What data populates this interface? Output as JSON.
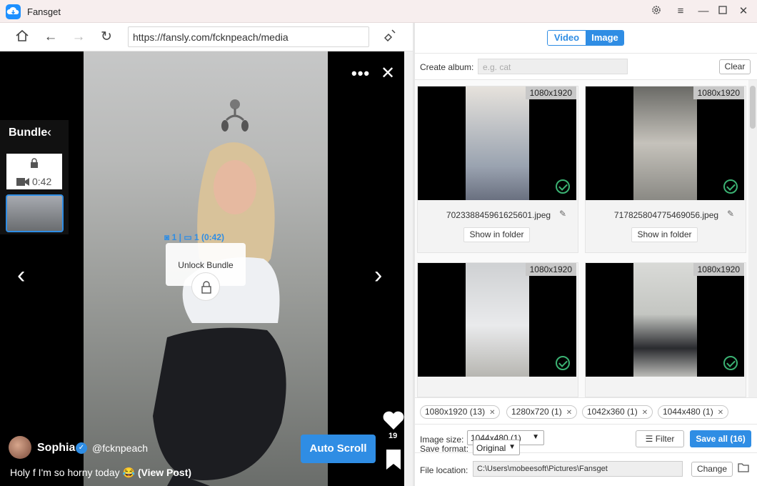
{
  "app": {
    "name": "Fansget"
  },
  "browser": {
    "url": "https://fansly.com/fcknpeach/media"
  },
  "bundle": {
    "title": "Bundle",
    "thumb_duration": "0:42"
  },
  "unlock": {
    "photos": "1",
    "videos": "1 (0:42)",
    "label": "Unlock Bundle"
  },
  "post": {
    "creator_name": "Sophia",
    "creator_handle": "@fcknpeach",
    "caption": "Holy f I'm so horny today 😂",
    "caption_link": "(View Post)",
    "likes": "19",
    "auto_scroll_label": "Auto Scroll"
  },
  "tabs": {
    "video": "Video",
    "image": "Image",
    "active": "Image"
  },
  "album": {
    "label": "Create album:",
    "placeholder": "e.g. cat",
    "clear_label": "Clear"
  },
  "cards": [
    {
      "resolution": "1080x1920",
      "filename": "702338845961625601.jpeg",
      "button": "Show in folder"
    },
    {
      "resolution": "1080x1920",
      "filename": "717825804775469056.jpeg",
      "button": "Show in folder"
    },
    {
      "resolution": "1080x1920",
      "filename": "",
      "button": ""
    },
    {
      "resolution": "1080x1920",
      "filename": "",
      "button": ""
    }
  ],
  "size_tags": [
    "1080x1920 (13)",
    "1280x720 (1)",
    "1042x360 (1)",
    "1044x480 (1)"
  ],
  "size_filter": {
    "label": "Image size:",
    "value": "1044x480 (1)",
    "filter_label": "Filter",
    "save_all_label": "Save all (16)"
  },
  "save_format": {
    "label": "Save format:",
    "value": "Original"
  },
  "file_location": {
    "label": "File location:",
    "value": "C:\\Users\\mobeesoft\\Pictures\\Fansget",
    "change_label": "Change"
  },
  "colors": {
    "accent": "#2f8de4",
    "check": "#3bb273",
    "titlebar": "#f7eeee"
  }
}
